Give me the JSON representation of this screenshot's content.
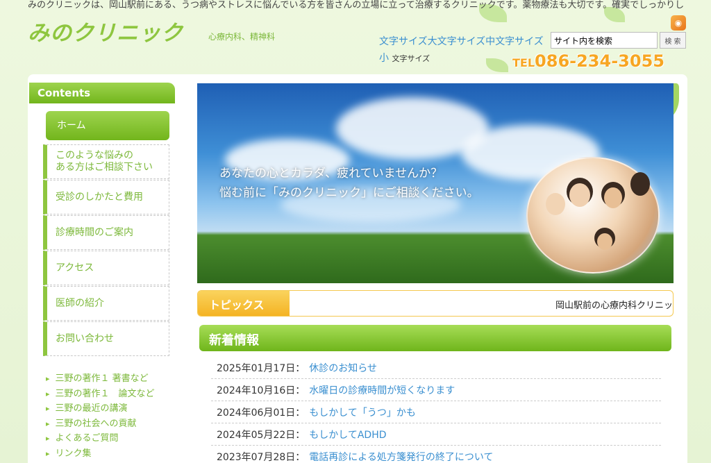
{
  "header": {
    "tagline": "みのクリニックは、岡山駅前にある、うつ病やストレスに悩んでいる方を皆さんの立場に立って治療するクリニックです。薬物療法も大切です。確実でしっかりし",
    "logo": "みのクリニック",
    "logo_sub": "心療内科、精神科",
    "font_size": {
      "large": "文字サイズ大",
      "medium": "文字サイズ中",
      "small": "文字サイズ小",
      "label": "文字サイズ"
    },
    "search_value": "サイト内を検索",
    "search_button": "検 索",
    "tel_prefix": "TEL",
    "tel_number": "086-234-3055"
  },
  "sidebar": {
    "heading": "Contents",
    "nav": [
      {
        "label": "ホーム"
      },
      {
        "label": "このような悩みの\nある方はご相談下さい"
      },
      {
        "label": "受診のしかたと費用"
      },
      {
        "label": "診療時間のご案内"
      },
      {
        "label": "アクセス"
      },
      {
        "label": "医師の紹介"
      },
      {
        "label": "お問い合わせ"
      }
    ],
    "sub_links": [
      {
        "label": "三野の著作１ 著書など"
      },
      {
        "label": "三野の著作１　論文など"
      },
      {
        "label": "三野の最近の講演"
      },
      {
        "label": "三野の社会への貢献"
      },
      {
        "label": "よくあるご質問"
      },
      {
        "label": "リンク集"
      }
    ]
  },
  "hero": {
    "line1": "あなたの心とカラダ、疲れていませんか？",
    "line2": "悩む前に「みのクリニック」にご相談ください。"
  },
  "topics": {
    "label": "トピックス",
    "ticker": "岡山駅前の心療内科クリニッ"
  },
  "news": {
    "heading": "新着情報",
    "items": [
      {
        "date": "2025年01月17日：",
        "title": "休診のお知らせ"
      },
      {
        "date": "2024年10月16日：",
        "title": "水曜日の診療時間が短くなります"
      },
      {
        "date": "2024年06月01日：",
        "title": "もしかして「うつ」かも"
      },
      {
        "date": "2024年05月22日：",
        "title": "もしかしてADHD"
      },
      {
        "date": "2023年07月28日：",
        "title": "電話再診による処方箋発行の終了について"
      }
    ]
  },
  "colors": {
    "brand_green": "#8ec63f",
    "accent_orange": "#f7a622",
    "link_blue": "#3a8fd0",
    "topics_yellow": "#f4b323"
  }
}
